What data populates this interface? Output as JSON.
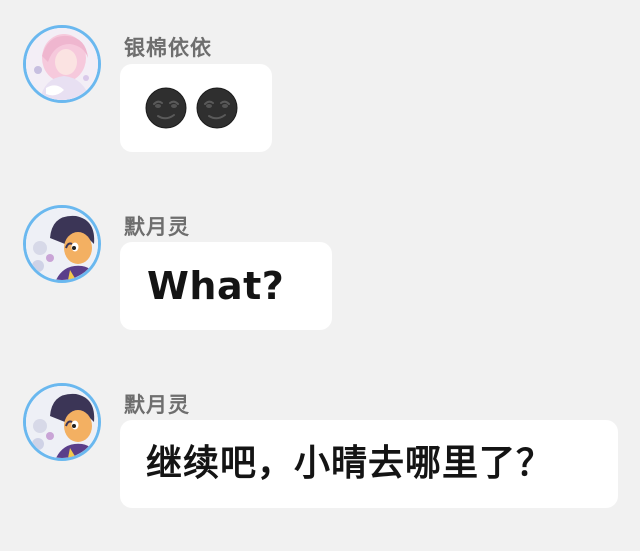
{
  "messages": [
    {
      "sender": "银棉依依",
      "avatar_icon": "anime-girl-avatar-icon",
      "content_type": "emoji",
      "emojis": [
        "new-moon-face-emoji-icon",
        "new-moon-face-emoji-icon"
      ]
    },
    {
      "sender": "默月灵",
      "avatar_icon": "anime-boy-avatar-icon",
      "content_type": "text",
      "text": "What?"
    },
    {
      "sender": "默月灵",
      "avatar_icon": "anime-boy-avatar-icon",
      "content_type": "text",
      "text": "继续吧，小晴去哪里了？"
    }
  ],
  "colors": {
    "background": "#f1f1f1",
    "bubble": "#ffffff",
    "avatar_ring": "#6ab8ef",
    "sender_name": "#6e6e6e",
    "message_text": "#141414"
  }
}
